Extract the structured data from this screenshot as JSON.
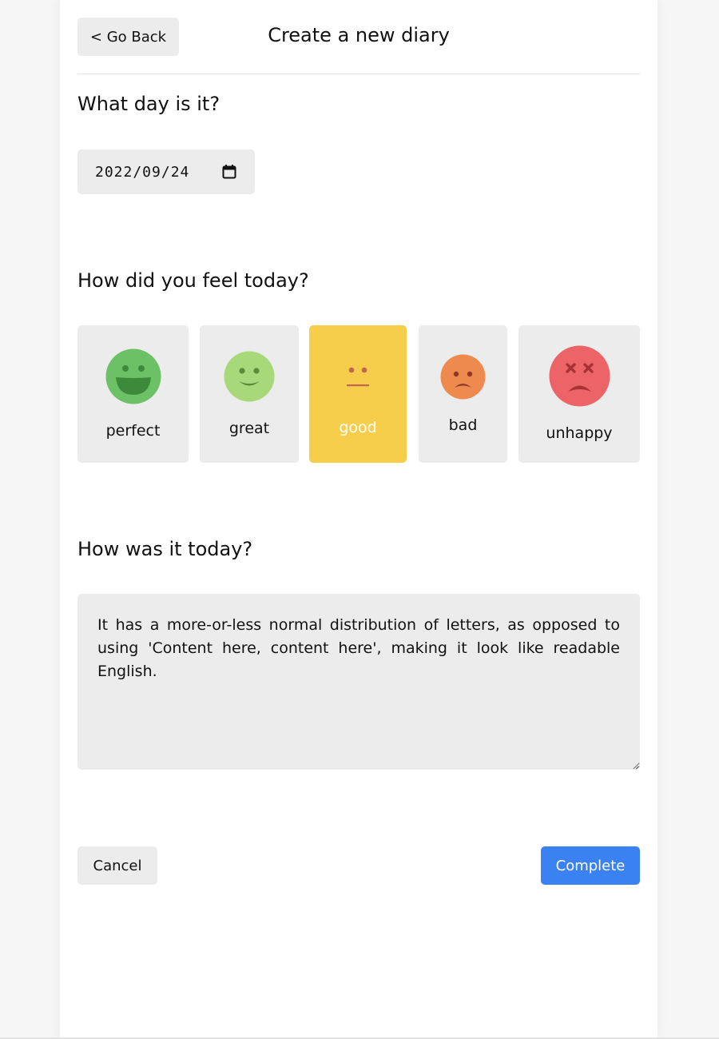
{
  "header": {
    "back_label": "< Go Back",
    "title": "Create a new diary"
  },
  "date_section": {
    "question": "What day is it?",
    "date_value": "2022/09/24"
  },
  "mood_section": {
    "question": "How did you feel today?",
    "selected": "good",
    "options": [
      {
        "label": "perfect",
        "icon": "laughing-face-icon",
        "color": "#6cc167"
      },
      {
        "label": "great",
        "icon": "smiling-face-icon",
        "color": "#a7d97a"
      },
      {
        "label": "good",
        "icon": "neutral-face-icon",
        "color": "#f6ce4c"
      },
      {
        "label": "bad",
        "icon": "frowning-face-icon",
        "color": "#ee8a4e"
      },
      {
        "label": "unhappy",
        "icon": "dizzy-face-icon",
        "color": "#ec6467"
      }
    ]
  },
  "notes_section": {
    "question": "How was it today?",
    "text": "It has a more-or-less normal distribution of letters, as opposed to using 'Content here, content here', making it look like readable English."
  },
  "footer": {
    "cancel_label": "Cancel",
    "complete_label": "Complete"
  },
  "colors": {
    "accent": "#3a81f1",
    "selected_mood": "#f6ce4c",
    "control_bg": "#ececec"
  }
}
